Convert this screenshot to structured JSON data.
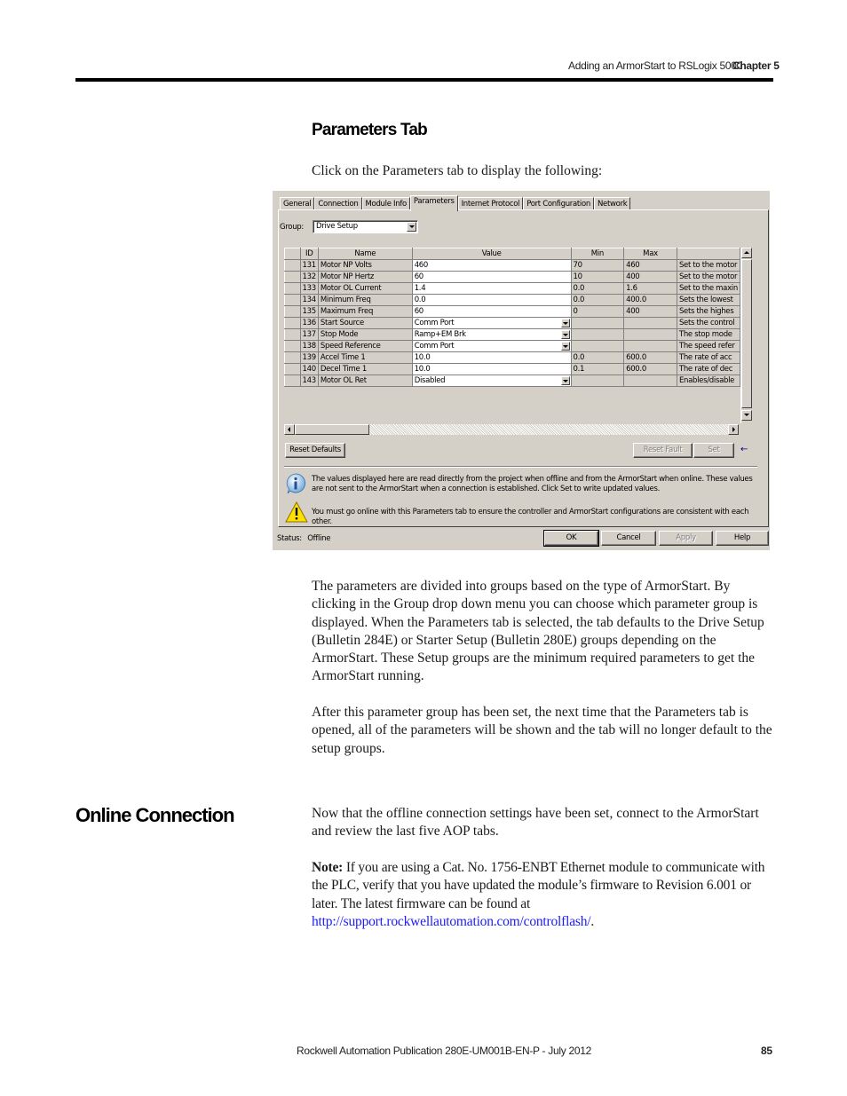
{
  "header": {
    "running_title": "Adding an ArmorStart to RSLogix 5000",
    "chapter": "Chapter 5"
  },
  "section1": {
    "heading": "Parameters Tab",
    "intro": "Click on the Parameters tab to display the following:"
  },
  "dialog": {
    "tabs": [
      {
        "label": "General"
      },
      {
        "label": "Connection"
      },
      {
        "label": "Module Info"
      },
      {
        "label": "Parameters",
        "active": true
      },
      {
        "label": "Internet Protocol"
      },
      {
        "label": "Port Configuration"
      },
      {
        "label": "Network"
      }
    ],
    "group_label": "Group:",
    "group_value": "Drive Setup",
    "columns": [
      "ID",
      "Name",
      "Value",
      "Min",
      "Max",
      ""
    ],
    "rows": [
      {
        "id": "131",
        "name": "Motor NP Volts",
        "value": "460",
        "dropdown": false,
        "min": "70",
        "max": "460",
        "desc": "Set to the motor"
      },
      {
        "id": "132",
        "name": "Motor NP Hertz",
        "value": "60",
        "dropdown": false,
        "min": "10",
        "max": "400",
        "desc": "Set to the motor"
      },
      {
        "id": "133",
        "name": "Motor OL Current",
        "value": "1.4",
        "dropdown": false,
        "min": "0.0",
        "max": "1.6",
        "desc": "Set to the maxin"
      },
      {
        "id": "134",
        "name": "Minimum Freq",
        "value": "0.0",
        "dropdown": false,
        "min": "0.0",
        "max": "400.0",
        "desc": "Sets the lowest"
      },
      {
        "id": "135",
        "name": "Maximum Freq",
        "value": "60",
        "dropdown": false,
        "min": "0",
        "max": "400",
        "desc": "Sets the highes"
      },
      {
        "id": "136",
        "name": "Start Source",
        "value": "Comm Port",
        "dropdown": true,
        "min": "",
        "max": "",
        "desc": "Sets the control"
      },
      {
        "id": "137",
        "name": "Stop Mode",
        "value": "Ramp+EM Brk",
        "dropdown": true,
        "min": "",
        "max": "",
        "desc": "The stop mode"
      },
      {
        "id": "138",
        "name": "Speed Reference",
        "value": "Comm Port",
        "dropdown": true,
        "min": "",
        "max": "",
        "desc": "The speed refer"
      },
      {
        "id": "139",
        "name": "Accel Time 1",
        "value": "10.0",
        "dropdown": false,
        "min": "0.0",
        "max": "600.0",
        "desc": "The rate of acc"
      },
      {
        "id": "140",
        "name": "Decel Time 1",
        "value": "10.0",
        "dropdown": false,
        "min": "0.1",
        "max": "600.0",
        "desc": "The rate of dec"
      },
      {
        "id": "143",
        "name": "Motor OL Ret",
        "value": "Disabled",
        "dropdown": true,
        "min": "",
        "max": "",
        "desc": "Enables/disable"
      }
    ],
    "buttons": {
      "reset_defaults": "Reset Defaults",
      "reset_fault": "Reset Fault",
      "set": "Set",
      "ok": "OK",
      "cancel": "Cancel",
      "apply": "Apply",
      "help": "Help"
    },
    "info_message": "The values displayed here are read directly from the project when offline and from the ArmorStart when online. These values are not sent to the ArmorStart when a connection is established.  Click Set to write updated values.",
    "warning_message": "You must go online with this Parameters tab to ensure the controller and ArmorStart configurations are consistent with each other.",
    "status_label": "Status:",
    "status_value": "Offline"
  },
  "section1_body": [
    "The parameters are divided into groups based on the type of ArmorStart. By clicking in the Group drop down menu you can choose which parameter group is displayed. When the Parameters tab is selected, the tab defaults to the Drive Setup (Bulletin 284E) or Starter Setup (Bulletin 280E) groups depending on the ArmorStart. These Setup groups are the minimum required parameters to get the ArmorStart running.",
    "After this parameter group has been set, the next time that the Parameters tab is opened, all of the parameters will be shown and the tab will no longer default to the setup groups."
  ],
  "section2": {
    "heading": "Online Connection",
    "para1": "Now that the offline connection settings have been set, connect to the ArmorStart and review the last five AOP tabs.",
    "note_label": "Note:",
    "note_text": " If you are using a Cat. No. 1756-ENBT Ethernet module to communicate with the PLC, verify that you have updated the module’s firmware to Revision 6.001 or later. The latest firmware can be found at ",
    "note_link": "http://support.rockwellautomation.com/controlflash/",
    "note_end": "."
  },
  "footer": {
    "publication": "Rockwell Automation Publication 280E-UM001B-EN-P - July 2012",
    "page_number": "85"
  }
}
